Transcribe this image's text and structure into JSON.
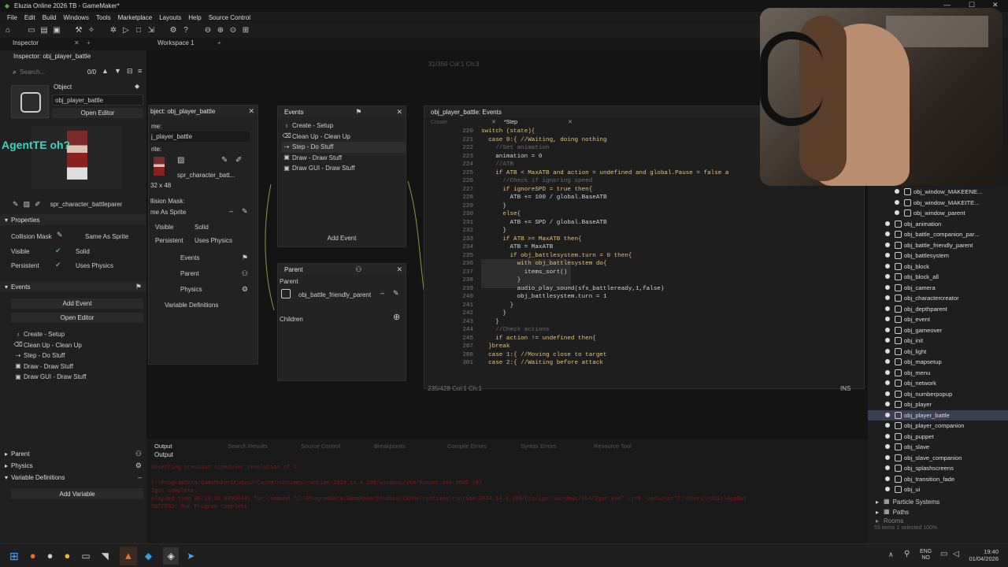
{
  "app": {
    "window_title": "Eluzia Online 2026 TB - GameMaker*"
  },
  "menu": [
    "File",
    "Edit",
    "Build",
    "Windows",
    "Tools",
    "Marketplace",
    "Layouts",
    "Help",
    "Source Control"
  ],
  "tabs": {
    "inspector_tab": "Inspector",
    "workspace_tab": "Workspace 1",
    "add_tab": "+"
  },
  "inspector": {
    "title": "Inspector: obj_player_battle",
    "search_placeholder": "Search...",
    "count": "0/0",
    "object_label": "Object",
    "object_name": "obj_player_battle",
    "open_editor": "Open Editor",
    "sprite_name": "spr_character_battleparer",
    "watermark": "AgentTE oh?",
    "properties_label": "Properties",
    "collision_mask_label": "Collision Mask",
    "collision_mask_value": "Same As Sprite",
    "visible_label": "Visible",
    "solid_label": "Solid",
    "persistent_label": "Persistent",
    "uses_physics_label": "Uses Physics",
    "events_label": "Events",
    "add_event": "Add Event",
    "open_editor_2": "Open Editor",
    "events": [
      "Create - Setup",
      "Clean Up - Clean Up",
      "Step - Do Stuff",
      "Draw - Draw Stuff",
      "Draw GUI - Draw Stuff"
    ],
    "parent_label": "Parent",
    "physics_label": "Physics",
    "variable_definitions_label": "Variable Definitions",
    "add_variable": "Add Variable"
  },
  "object_window": {
    "title": "bject: obj_player_battle",
    "name_label": "me:",
    "name_value": "j_player_battle",
    "sprite_label": "rite:",
    "sprite_value": "spr_character_batt...",
    "sprite_size": "32 x 48",
    "collision_mask_label": "llision Mask:",
    "collision_mask_value": "me As Sprite",
    "visible": "Visible",
    "solid": "Solid",
    "persistent": "Persistent",
    "uses_physics": "Uses Physics",
    "events_btn": "Events",
    "parent_btn": "Parent",
    "physics_btn": "Physics",
    "variable_definitions_btn": "Variable Definitions"
  },
  "events_window": {
    "title": "Events",
    "events": [
      "Create - Setup",
      "Clean Up - Clean Up",
      "Step - Do Stuff",
      "Draw - Draw Stuff",
      "Draw GUI - Draw Stuff"
    ],
    "add_event": "Add Event"
  },
  "parent_window": {
    "title": "Parent",
    "parent_label": "Parent",
    "parent_value": "obj_battle_friendly_parent",
    "children_label": "Children"
  },
  "code_window": {
    "title": "obj_player_battle: Events",
    "tab_create": "Create",
    "tab_step": "*Step",
    "status_top": "31/350 Col:1 Ch:3",
    "status_bottom": "235/428 Col:1 Ch:1",
    "ins": "INS",
    "line_numbers": [
      "220",
      "221",
      "222",
      "223",
      "224",
      "225",
      "226",
      "227",
      "228",
      "229",
      "230",
      "231",
      "232",
      "233",
      "234",
      "235",
      "236",
      "237",
      "238",
      "239",
      "240",
      "241",
      "242",
      "243",
      "244",
      "245",
      "287",
      "288",
      "301"
    ],
    "lines": [
      "switch (state){",
      "  case 0:{ //Waiting, doing nothing",
      "    //Set animation",
      "    animation = 0",
      "    //ATB",
      "    if ATB < MaxATB and action = undefined and global.Pause = false a",
      "      //Check if ignoring speed",
      "      if ignoreSPD = true then{",
      "        ATB += 100 / global.BaseATB",
      "      }",
      "      else{",
      "        ATB += SPD / global.BaseATB",
      "      }",
      "      if ATB >= MaxATB then{",
      "        ATB = MaxATB",
      "        if obj_battlesystem.turn = 0 then{",
      "          with obj_battlesystem do{",
      "            items_sort()",
      "          }",
      "          audio_play_sound(sfx_battleready,1,false)",
      "          obj_battlesystem.turn = 1",
      "        }",
      "      }",
      "    }",
      "    //Check actions",
      "    if action != undefined then{",
      "  }break",
      "  case 1:{ //Moving close to target",
      "  case 2:{ //Waiting before attack"
    ]
  },
  "output": {
    "tabs": [
      "Output",
      "Search Results",
      "Source Control",
      "Breakpoints",
      "Compile Errors",
      "Syntax Errors",
      "Resource Tool"
    ],
    "subtitle": "Output",
    "lines": [
      "Unsetting previous scheduler resolution of 1",
      "",
      "C:\\ProgramData/GameMakerStudio2/Cache/runtimes\\runtime-2024.14.4.208/windows/x64/Runner.exe DONE (0)",
      "Igor complete.",
      "elapsed time 00:10:31.9495044s for command \"C:\\ProgramData/GameMakerStudio2/Cache/runtimes\\runtime-2024.14.4.208/bin/igor/windows/x64/Igor.exe\" -j=8 -options=\"C:\\Users\\robin\\AppDat",
      "SUCCESS: Run Program Complete"
    ]
  },
  "resources": {
    "items": [
      {
        "name": "obj_window_MAKEENE...",
        "indent": 2
      },
      {
        "name": "obj_window_MAKEITE...",
        "indent": 2
      },
      {
        "name": "obj_window_parent",
        "indent": 2
      },
      {
        "name": "obj_animation",
        "indent": 1
      },
      {
        "name": "obj_battle_companion_par...",
        "indent": 1
      },
      {
        "name": "obj_battle_friendly_parent",
        "indent": 1
      },
      {
        "name": "obj_battlesystem",
        "indent": 1
      },
      {
        "name": "obj_block",
        "indent": 1
      },
      {
        "name": "obj_block_all",
        "indent": 1
      },
      {
        "name": "obj_camera",
        "indent": 1
      },
      {
        "name": "obj_charactercreator",
        "indent": 1
      },
      {
        "name": "obj_depthparent",
        "indent": 1
      },
      {
        "name": "obj_event",
        "indent": 1
      },
      {
        "name": "obj_gameover",
        "indent": 1
      },
      {
        "name": "obj_init",
        "indent": 1
      },
      {
        "name": "obj_light",
        "indent": 1
      },
      {
        "name": "obj_mapsetup",
        "indent": 1
      },
      {
        "name": "obj_menu",
        "indent": 1
      },
      {
        "name": "obj_network",
        "indent": 1
      },
      {
        "name": "obj_numberpopup",
        "indent": 1
      },
      {
        "name": "obj_player",
        "indent": 1
      },
      {
        "name": "obj_player_battle",
        "indent": 1,
        "selected": true
      },
      {
        "name": "obj_player_companion",
        "indent": 1
      },
      {
        "name": "obj_puppet",
        "indent": 1
      },
      {
        "name": "obj_slave",
        "indent": 1
      },
      {
        "name": "obj_slave_companion",
        "indent": 1
      },
      {
        "name": "obj_splashscreens",
        "indent": 1
      },
      {
        "name": "obj_transition_fade",
        "indent": 1
      },
      {
        "name": "obj_ui",
        "indent": 1
      }
    ],
    "folders": [
      "Particle Systems",
      "Paths",
      "Rooms"
    ],
    "footer": "53 items  1 selected  100%"
  },
  "taskbar": {
    "lang_top": "ENG",
    "lang_bottom": "NO",
    "time": "19:40",
    "date": "01/04/2026"
  }
}
